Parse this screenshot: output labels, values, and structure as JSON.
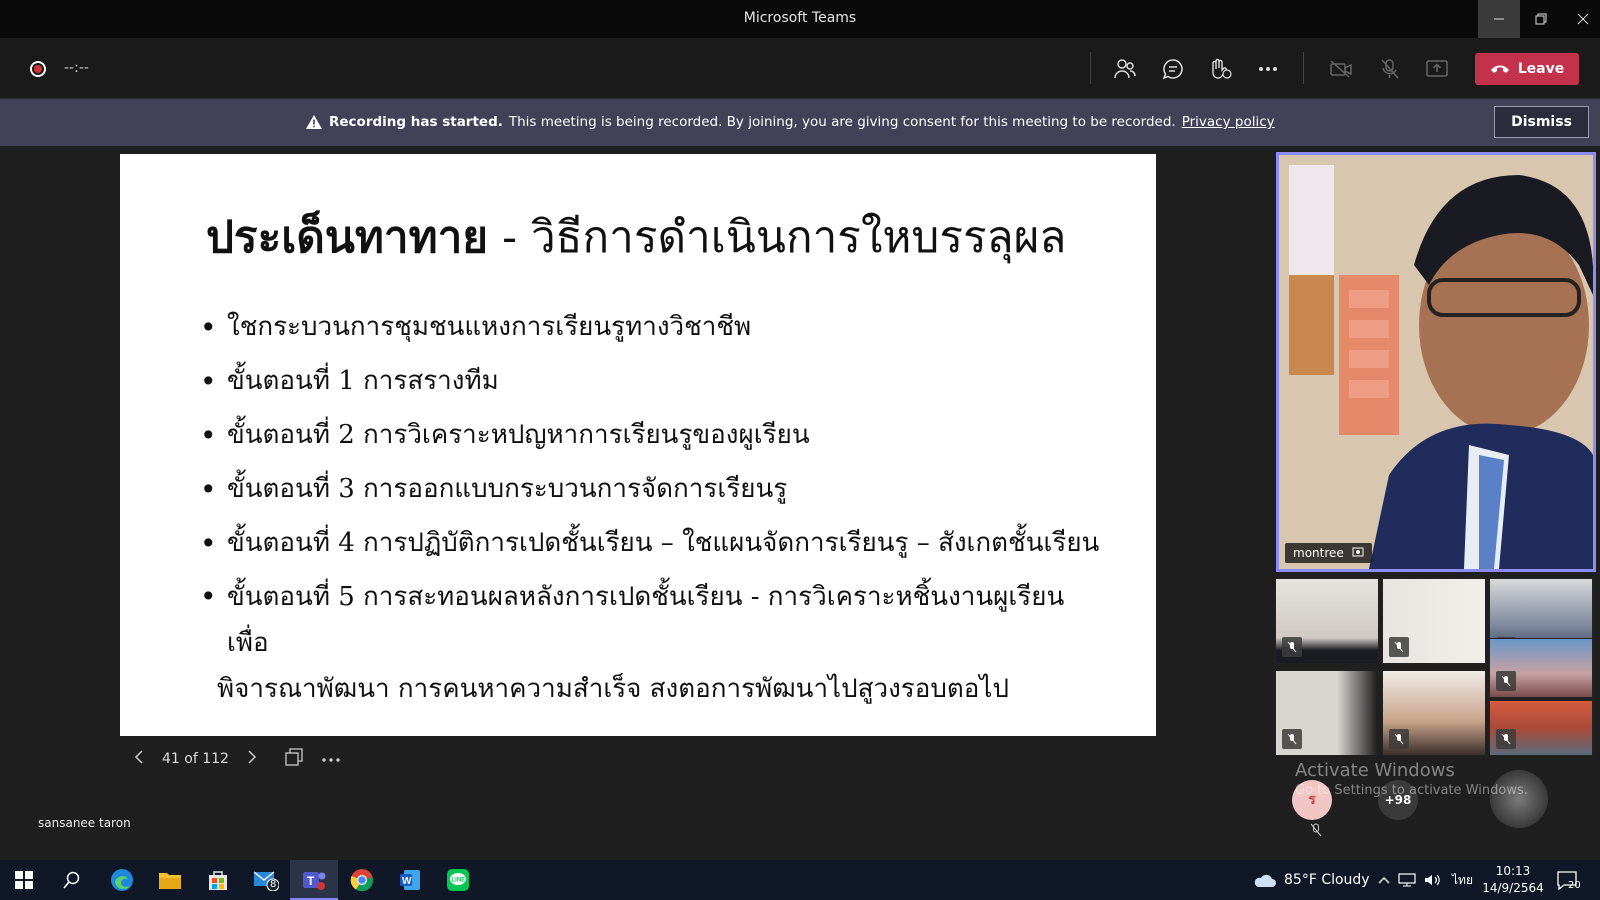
{
  "window": {
    "title": "Microsoft Teams"
  },
  "toolbar": {
    "timer": "--:--",
    "leave_label": "Leave"
  },
  "banner": {
    "strong": "Recording has started.",
    "message": "This meeting is being recorded. By joining, you are giving consent for this meeting to be recorded.",
    "link": "Privacy policy",
    "dismiss_label": "Dismiss"
  },
  "slide": {
    "title_bold": "ประเด็นทาทาย",
    "title_dash": " - ",
    "title_rest": "วิธีการดำเนินการใหบรรลุผล",
    "bullets": [
      "ใชกระบวนการชุมชนแหงการเรียนรูทางวิชาชีพ",
      "ขั้นตอนที่ 1 การสรางทีม",
      "ขั้นตอนที่ 2 การวิเคราะหปญหาการเรียนรูของผูเรียน",
      "ขั้นตอนที่ 3 การออกแบบกระบวนการจัดการเรียนรู",
      "ขั้นตอนที่ 4 การปฏิบัติการเปดชั้นเรียน – ใชแผนจัดการเรียนรู – สังเกตชั้นเรียน",
      "ขั้นตอนที่ 5 การสะทอนผลหลังการเปดชั้นเรียน - การวิเคราะหชิ้นงานผูเรียนเพื่อ"
    ],
    "bullet_continuation": "พิจารณาพัฒนา  การคนหาความสำเร็จ สงตอการพัฒนาไปสูวงรอบตอไป"
  },
  "slide_nav": {
    "page": "41 of 112"
  },
  "presenter": {
    "name": "sansanee taron"
  },
  "main_video": {
    "name": "montree"
  },
  "overflow": {
    "count": "+98"
  },
  "watermark": {
    "line1": "Activate Windows",
    "line2": "Go to Settings to activate Windows."
  },
  "taskbar": {
    "mail_badge": "8",
    "weather": "85°F  Cloudy",
    "lang": "ไทย",
    "time": "10:13",
    "date": "14/9/2564",
    "notifications": "20"
  },
  "colors": {
    "leave": "#c4314b",
    "banner": "#414257",
    "active_speaker": "#8b8cf5",
    "recording": "#d13438"
  }
}
